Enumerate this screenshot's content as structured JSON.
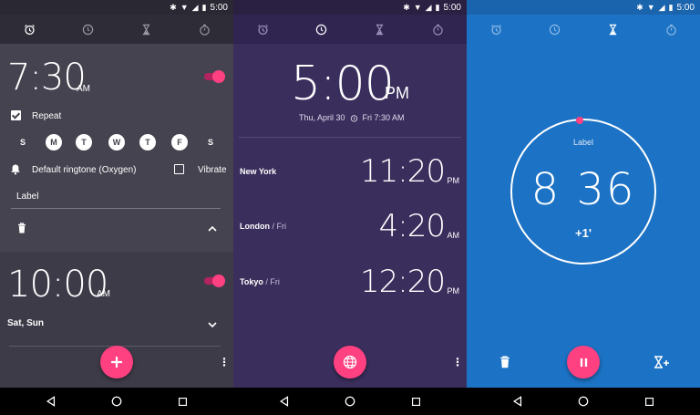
{
  "status_bar": {
    "time": "5:00"
  },
  "alarm_screen": {
    "alarm1": {
      "time": "7:30",
      "ampm": "AM",
      "repeat_label": "Repeat",
      "days": [
        {
          "letter": "S",
          "on": false
        },
        {
          "letter": "M",
          "on": true
        },
        {
          "letter": "T",
          "on": true
        },
        {
          "letter": "W",
          "on": true
        },
        {
          "letter": "T",
          "on": true
        },
        {
          "letter": "F",
          "on": true
        },
        {
          "letter": "S",
          "on": false
        }
      ],
      "ringtone": "Default ringtone (Oxygen)",
      "vibrate_label": "Vibrate",
      "label_placeholder": "Label"
    },
    "alarm2": {
      "time": "10:00",
      "ampm": "AM",
      "days_summary": "Sat, Sun"
    }
  },
  "clock_screen": {
    "time": "5:00",
    "ampm": "PM",
    "date": "Thu, April 30",
    "next_alarm": "Fri 7:30 AM",
    "cities": [
      {
        "name": "New York",
        "day": "",
        "time": "11:20",
        "ampm": "PM"
      },
      {
        "name": "London",
        "day": " / Fri",
        "time": "4:20",
        "ampm": "AM"
      },
      {
        "name": "Tokyo",
        "day": " / Fri",
        "time": "12:20",
        "ampm": "PM"
      }
    ]
  },
  "timer_screen": {
    "label": "Label",
    "time": "8 36",
    "add_minute": "+1'"
  },
  "colors": {
    "accent": "#ff4081",
    "alarm_bg": "#3d3b48",
    "clock_bg": "#3a2e5c",
    "timer_bg": "#1c72c4"
  }
}
